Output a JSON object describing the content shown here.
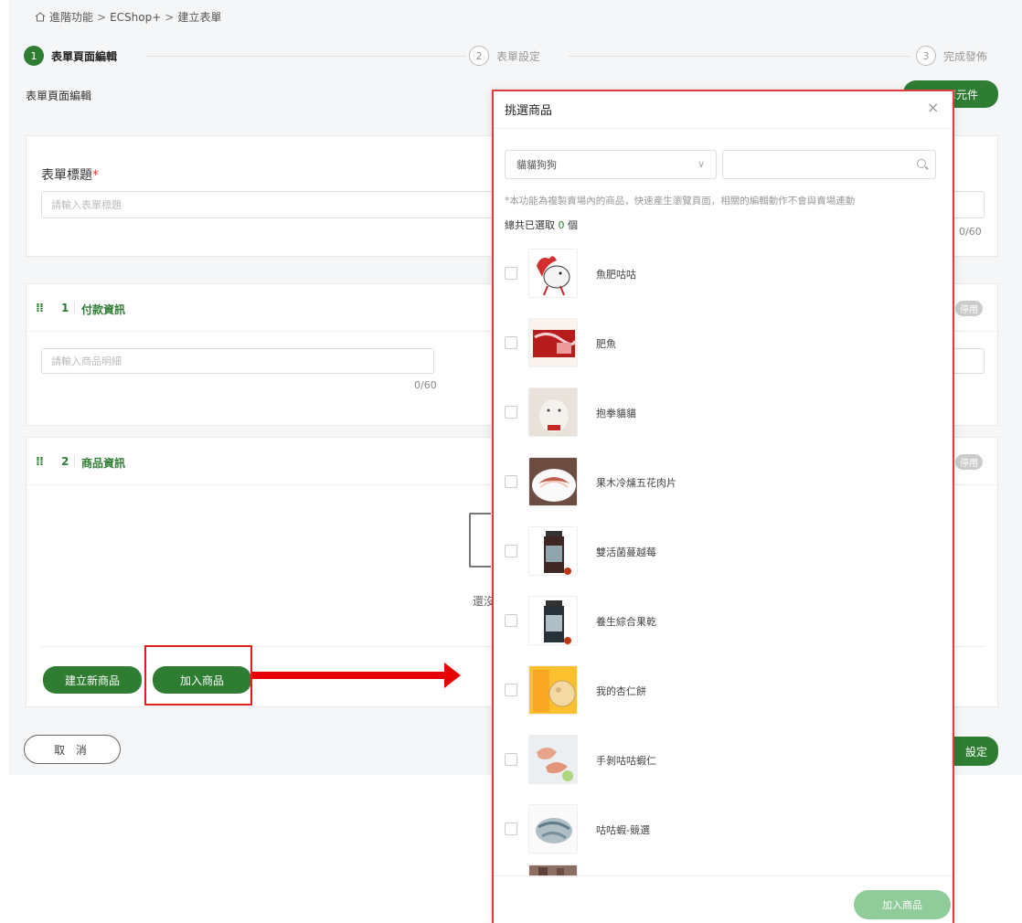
{
  "breadcrumb": {
    "home": "進階功能",
    "sep": ">",
    "level2": "ECShop+",
    "level3": "建立表單"
  },
  "steps": [
    {
      "num": "1",
      "label": "表單頁面編輯"
    },
    {
      "num": "2",
      "label": "表單設定"
    },
    {
      "num": "3",
      "label": "完成發佈"
    }
  ],
  "section_title": "表單頁面編輯",
  "add_component_label": "單元件",
  "form_title": {
    "label": "表單標題",
    "required_mark": "*",
    "placeholder": "請輸入表單標題",
    "count": "0/60"
  },
  "payment": {
    "num": "1",
    "name": "付款資訊",
    "badge": "停用",
    "placeholder": "請輸入商品明細",
    "count": "0/60"
  },
  "product": {
    "num": "2",
    "name": "商品資訊",
    "badge": "停用",
    "empty_text": "還沒",
    "new_button": "建立新商品",
    "add_button": "加入商品"
  },
  "cancel_button": "取 消",
  "next_button": "設定",
  "modal": {
    "title": "挑選商品",
    "close": "×",
    "select_value": "貓貓狗狗",
    "search_placeholder": "",
    "note": "*本功能為複製賣場內的商品，快速產生瀏覽頁面，相關的編輯動作不會與賣場連動",
    "count_prefix": "總共已選取",
    "count_num": "0",
    "count_suffix": "個",
    "items": [
      {
        "name": "魚肥咕咕",
        "icon": "rooster-photo"
      },
      {
        "name": "肥魚",
        "icon": "fish-roe-photo"
      },
      {
        "name": "抱拳貓貓",
        "icon": "cat-figurine-photo"
      },
      {
        "name": "果木冷燻五花肉片",
        "icon": "bacon-plate-photo"
      },
      {
        "name": "雙活菌蔓越莓",
        "icon": "jar-photo"
      },
      {
        "name": "養生綜合果乾",
        "icon": "jar-photo"
      },
      {
        "name": "我的杏仁餅",
        "icon": "almond-cookie-photo"
      },
      {
        "name": "手剝咕咕蝦仁",
        "icon": "shrimp-photo"
      },
      {
        "name": "咕咕蝦-競選",
        "icon": "shrimp-photo"
      }
    ],
    "add_button": "加入商品"
  },
  "colors": {
    "brand_green": "#2e7d32",
    "annotation_red": "#e60000",
    "disabled_green": "#8fcc9a"
  }
}
